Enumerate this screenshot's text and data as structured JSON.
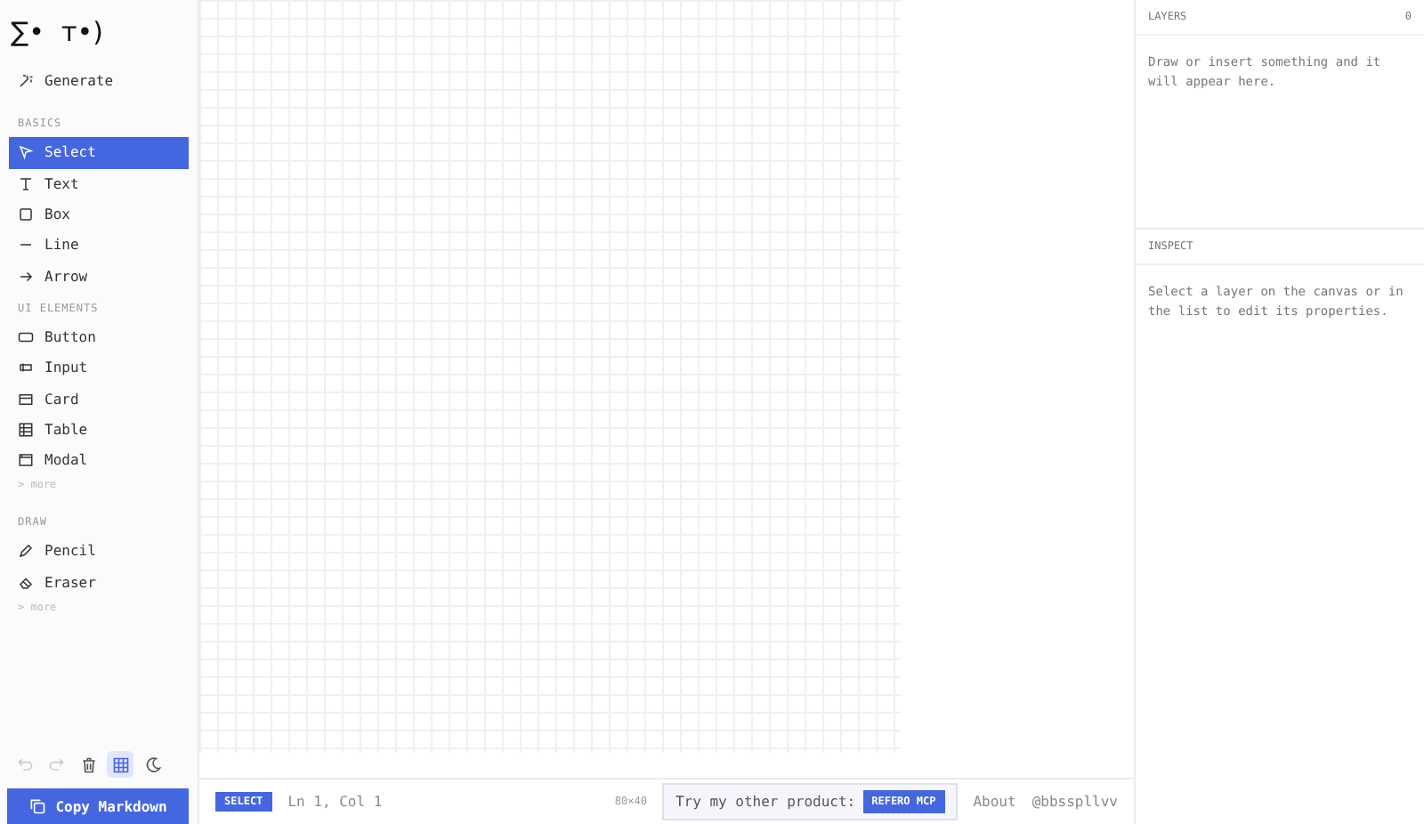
{
  "logo": "∑•  ᴛ•)",
  "generate": {
    "label": "Generate",
    "kind": "generate"
  },
  "sections": [
    {
      "title": "BASICS",
      "items": [
        {
          "label": "Select",
          "kind": "select",
          "selected": true
        },
        {
          "label": "Text",
          "kind": "text",
          "selected": false
        },
        {
          "label": "Box",
          "kind": "box",
          "selected": false
        },
        {
          "label": "Line",
          "kind": "line",
          "selected": false
        },
        {
          "label": "Arrow",
          "kind": "arrow",
          "selected": false
        }
      ]
    },
    {
      "title": "UI ELEMENTS",
      "more": "> more",
      "items": [
        {
          "label": "Button",
          "kind": "button",
          "selected": false
        },
        {
          "label": "Input",
          "kind": "input",
          "selected": false
        },
        {
          "label": "Card",
          "kind": "card",
          "selected": false
        },
        {
          "label": "Table",
          "kind": "table",
          "selected": false
        },
        {
          "label": "Modal",
          "kind": "modal",
          "selected": false
        }
      ]
    },
    {
      "title": "DRAW",
      "more": "> more",
      "items": [
        {
          "label": "Pencil",
          "kind": "pencil",
          "selected": false
        },
        {
          "label": "Eraser",
          "kind": "eraser",
          "selected": false
        }
      ]
    }
  ],
  "toolbar": [
    {
      "kind": "undo",
      "disabled": true,
      "selected": false
    },
    {
      "kind": "redo",
      "disabled": true,
      "selected": false
    },
    {
      "kind": "trash",
      "disabled": false,
      "selected": false
    },
    {
      "kind": "grid",
      "disabled": false,
      "selected": true
    },
    {
      "kind": "moon",
      "disabled": false,
      "selected": false
    }
  ],
  "copy_button": "Copy Markdown",
  "status_bar": {
    "mode": "SELECT",
    "position": "Ln 1, Col 1",
    "size": "80×40",
    "promo": "Try my other product:",
    "promo_button": "REFERO MCP",
    "about": "About",
    "handle": "@bbsspllvv"
  },
  "layers": {
    "title": "LAYERS",
    "count": "0",
    "empty": "Draw or insert something and it will appear here."
  },
  "inspect": {
    "title": "INSPECT",
    "empty": "Select a layer on the canvas or in the list to edit its properties."
  }
}
